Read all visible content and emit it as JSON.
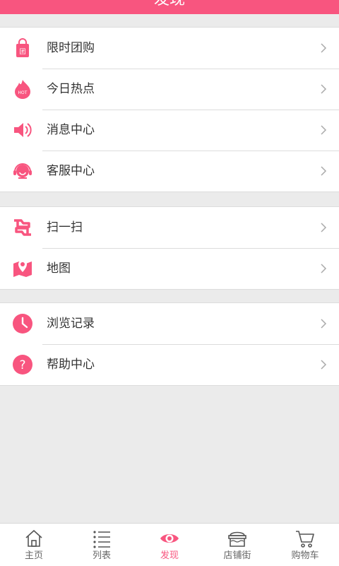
{
  "header": {
    "title": "发现"
  },
  "colors": {
    "accent": "#f8557f"
  },
  "groups": [
    {
      "items": [
        {
          "label": "限时团购",
          "icon": "shopping-bag-icon"
        },
        {
          "label": "今日热点",
          "icon": "hot-flame-icon"
        },
        {
          "label": "消息中心",
          "icon": "speaker-icon"
        },
        {
          "label": "客服中心",
          "icon": "headset-icon"
        }
      ]
    },
    {
      "items": [
        {
          "label": "扫一扫",
          "icon": "scan-icon"
        },
        {
          "label": "地图",
          "icon": "map-icon"
        }
      ]
    },
    {
      "items": [
        {
          "label": "浏览记录",
          "icon": "clock-icon"
        },
        {
          "label": "帮助中心",
          "icon": "question-icon"
        }
      ]
    }
  ],
  "tabbar": {
    "tabs": [
      {
        "label": "主页",
        "icon": "home-icon"
      },
      {
        "label": "列表",
        "icon": "list-icon"
      },
      {
        "label": "发现",
        "icon": "eye-icon",
        "active": true
      },
      {
        "label": "店铺街",
        "icon": "store-icon"
      },
      {
        "label": "购物车",
        "icon": "cart-icon"
      }
    ]
  }
}
